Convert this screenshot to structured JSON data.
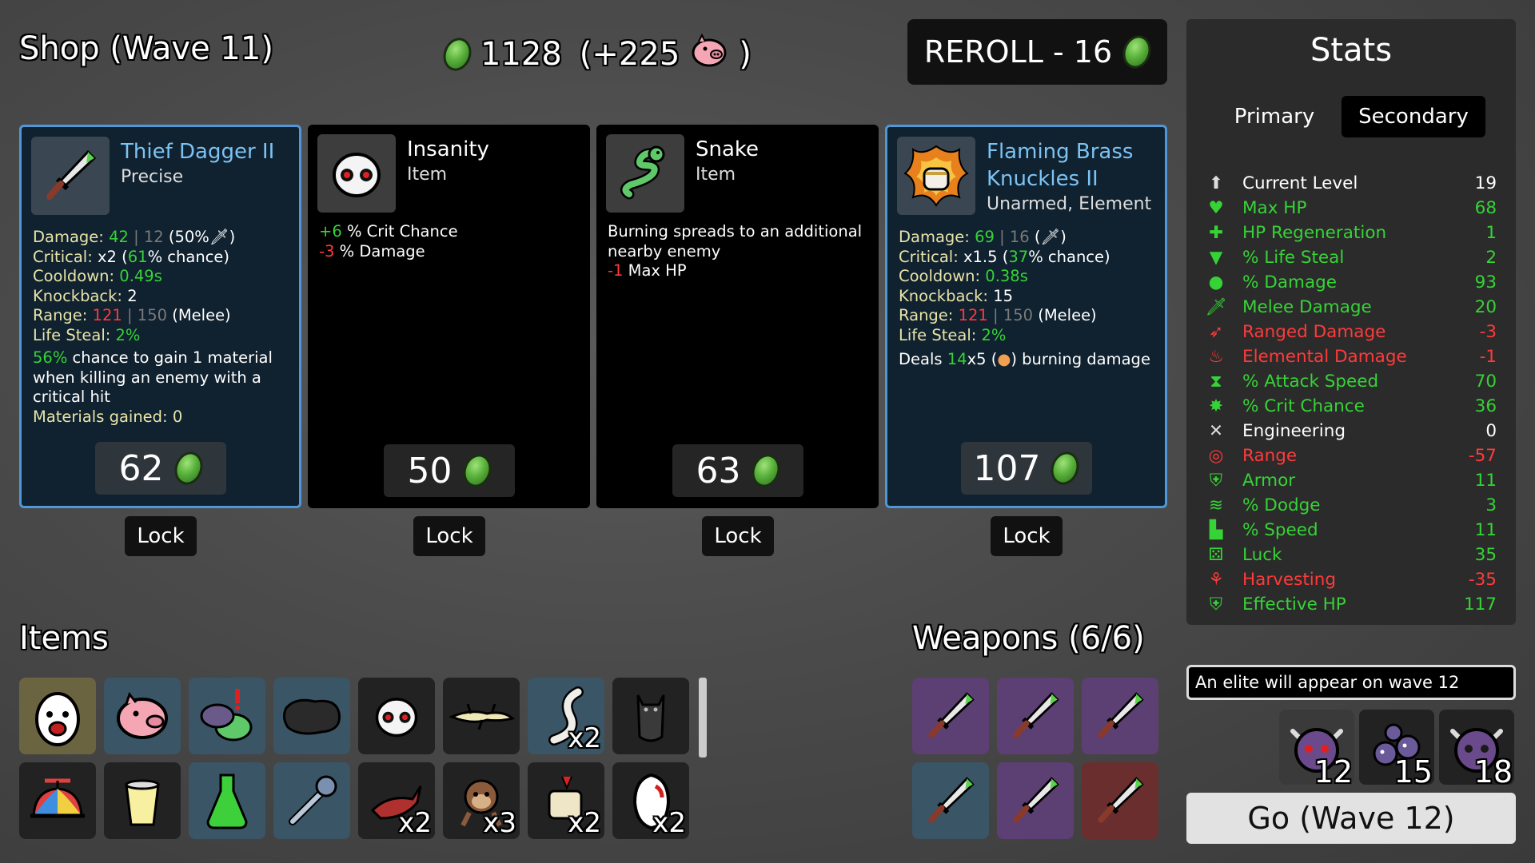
{
  "header": {
    "title": "Shop (Wave 11)",
    "materials": "1128",
    "materials_bonus_open": "(+225",
    "materials_bonus_close": ")",
    "reroll_label": "REROLL - 16"
  },
  "shop": [
    {
      "name": "Thief Dagger II",
      "subtitle": "Precise",
      "kind": "weapon",
      "icon": "dagger-icon",
      "price": "62",
      "lock_label": "Lock"
    },
    {
      "name": "Insanity",
      "subtitle": "Item",
      "kind": "item",
      "icon": "mask-icon",
      "price": "50",
      "lock_label": "Lock"
    },
    {
      "name": "Snake",
      "subtitle": "Item",
      "kind": "item",
      "icon": "snake-icon",
      "price": "63",
      "lock_label": "Lock"
    },
    {
      "name_line1": "Flaming Brass",
      "name_line2": "Knuckles II",
      "subtitle": "Unarmed, Element",
      "kind": "weapon",
      "icon": "flaming-fist-icon",
      "price": "107",
      "lock_label": "Lock"
    }
  ],
  "card1": {
    "damage_label": "Damage:",
    "damage_val": "42",
    "damage_base": "| 12",
    "damage_extra": "(50%",
    "damage_close": ")",
    "crit_label": "Critical:",
    "crit_mult": "x2",
    "crit_open": "(",
    "crit_pct": "61",
    "crit_rest": "% chance)",
    "cooldown_label": "Cooldown:",
    "cooldown_val": "0.49s",
    "knockback_label": "Knockback:",
    "knockback_val": "2",
    "range_label": "Range:",
    "range_val": "121",
    "range_base": "| 150",
    "range_type": "(Melee)",
    "lifesteal_label": "Life Steal:",
    "lifesteal_val": "2%",
    "effect_pct": "56%",
    "effect_text": "chance to gain 1 material when killing an enemy with a critical hit",
    "materials_gained": "Materials gained: 0"
  },
  "card2": {
    "line1_val": "+6",
    "line1_text": "% Crit Chance",
    "line2_val": "-3",
    "line2_text": "% Damage"
  },
  "card3": {
    "text": "Burning spreads to an additional nearby enemy",
    "hp_val": "-1",
    "hp_text": "Max HP"
  },
  "card4": {
    "damage_label": "Damage:",
    "damage_val": "69",
    "damage_base": "| 16",
    "damage_extra": "(",
    "damage_close": ")",
    "crit_label": "Critical:",
    "crit_mult": "x1.5",
    "crit_open": "(",
    "crit_pct": "37",
    "crit_rest": "% chance)",
    "cooldown_label": "Cooldown:",
    "cooldown_val": "0.38s",
    "knockback_label": "Knockback:",
    "knockback_val": "15",
    "range_label": "Range:",
    "range_val": "121",
    "range_base": "| 150",
    "range_type": "(Melee)",
    "lifesteal_label": "Life Steal:",
    "lifesteal_val": "2%",
    "burn_pre": "Deals",
    "burn_val": "14",
    "burn_mult": "x5",
    "burn_open": "(",
    "burn_post": ") burning damage"
  },
  "items": {
    "title": "Items",
    "row1": [
      {
        "icon": "egg-face-icon",
        "count": ""
      },
      {
        "icon": "piggy-bank-icon",
        "count": ""
      },
      {
        "icon": "alien-alert-icon",
        "count": ""
      },
      {
        "icon": "dark-rock-icon",
        "count": ""
      },
      {
        "icon": "mask-icon",
        "count": ""
      },
      {
        "icon": "lizard-icon",
        "count": ""
      },
      {
        "icon": "worm-icon",
        "count": "x2"
      },
      {
        "icon": "bat-icon",
        "count": ""
      }
    ],
    "row2": [
      {
        "icon": "propeller-hat-icon",
        "count": ""
      },
      {
        "icon": "lemonade-icon",
        "count": ""
      },
      {
        "icon": "potion-icon",
        "count": ""
      },
      {
        "icon": "wrench-icon",
        "count": ""
      },
      {
        "icon": "claw-icon",
        "count": "x2"
      },
      {
        "icon": "monkey-icon",
        "count": "x3"
      },
      {
        "icon": "scroll-icon",
        "count": "x2"
      },
      {
        "icon": "tooth-icon",
        "count": "x2"
      }
    ]
  },
  "weapons": {
    "title": "Weapons (6/6)",
    "slots": [
      "purple",
      "purple",
      "purple",
      "teal",
      "purple",
      "red"
    ]
  },
  "stats": {
    "title": "Stats",
    "tab_primary": "Primary",
    "tab_secondary": "Secondary",
    "rows": [
      {
        "label": "Current Level",
        "value": "19",
        "color": "#ffffff",
        "icon": "level-up-icon"
      },
      {
        "label": "Max HP",
        "value": "68",
        "color": "#36d336",
        "icon": "heart-icon"
      },
      {
        "label": "HP Regeneration",
        "value": "1",
        "color": "#36d336",
        "icon": "regen-icon"
      },
      {
        "label": "% Life Steal",
        "value": "2",
        "color": "#36d336",
        "icon": "fangs-icon"
      },
      {
        "label": "% Damage",
        "value": "93",
        "color": "#36d336",
        "icon": "brain-icon"
      },
      {
        "label": "Melee Damage",
        "value": "20",
        "color": "#36d336",
        "icon": "sword-icon"
      },
      {
        "label": "Ranged Damage",
        "value": "-3",
        "color": "#ff3a3a",
        "icon": "bow-icon"
      },
      {
        "label": "Elemental Damage",
        "value": "-1",
        "color": "#ff3a3a",
        "icon": "flame-icon"
      },
      {
        "label": "% Attack Speed",
        "value": "70",
        "color": "#36d336",
        "icon": "hourglass-icon"
      },
      {
        "label": "% Crit Chance",
        "value": "36",
        "color": "#36d336",
        "icon": "crit-icon"
      },
      {
        "label": "Engineering",
        "value": "0",
        "color": "#ffffff",
        "icon": "engineering-icon"
      },
      {
        "label": "Range",
        "value": "-57",
        "color": "#ff3a3a",
        "icon": "range-icon"
      },
      {
        "label": "Armor",
        "value": "11",
        "color": "#36d336",
        "icon": "shield-icon"
      },
      {
        "label": "% Dodge",
        "value": "3",
        "color": "#36d336",
        "icon": "dodge-icon"
      },
      {
        "label": "% Speed",
        "value": "11",
        "color": "#36d336",
        "icon": "boot-icon"
      },
      {
        "label": "Luck",
        "value": "35",
        "color": "#36d336",
        "icon": "dice-icon"
      },
      {
        "label": "Harvesting",
        "value": "-35",
        "color": "#ff3a3a",
        "icon": "wheat-icon"
      },
      {
        "label": "Effective HP",
        "value": "117",
        "color": "#36d336",
        "icon": "effective-hp-icon"
      }
    ]
  },
  "wave_info": {
    "elite_text": "An elite will appear on wave 12",
    "waves": [
      "12",
      "15",
      "18"
    ],
    "go_label": "Go (Wave 12)"
  }
}
